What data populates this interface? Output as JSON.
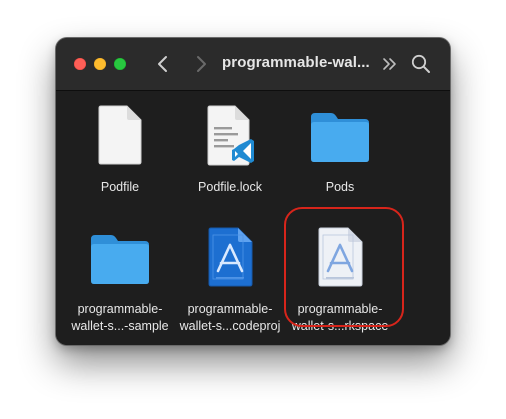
{
  "window": {
    "title": "programmable-wal...",
    "controls": {
      "close": "close",
      "minimize": "minimize",
      "zoom": "zoom"
    },
    "toolbar": {
      "back_icon": "chevron-left-icon",
      "forward_icon": "chevron-right-icon",
      "overflow_icon": "double-chevron-right-icon",
      "search_icon": "search-icon"
    }
  },
  "files": [
    {
      "name": "Podfile",
      "icon": "document-icon"
    },
    {
      "name": "Podfile.lock",
      "icon": "vscode-document-icon"
    },
    {
      "name": "Pods",
      "icon": "folder-icon"
    },
    {
      "name_line1": "programmable-",
      "name_line2": "wallet-s...-sample",
      "icon": "folder-icon"
    },
    {
      "name_line1": "programmable-",
      "name_line2": "wallet-s...codeproj",
      "icon": "xcode-project-icon"
    },
    {
      "name_line1": "programmable-",
      "name_line2": "wallet-s...rkspace",
      "icon": "xcode-workspace-icon",
      "highlighted": true
    }
  ],
  "colors": {
    "window_bg": "#1e1e1e",
    "titlebar_bg": "#2b2b2b",
    "folder_blue": "#41a6ee",
    "highlight_ring": "#d7251b"
  }
}
